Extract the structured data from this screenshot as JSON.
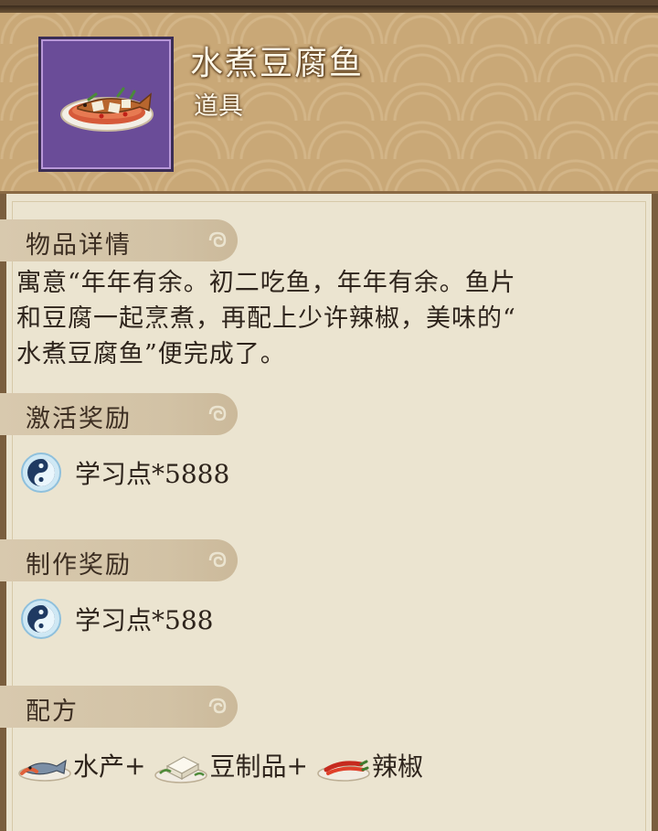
{
  "item": {
    "name": "水煮豆腐鱼",
    "category": "道具",
    "icon": "boiled-tofu-fish-dish-icon",
    "frame_color": "#6a4c98"
  },
  "sections": {
    "details": {
      "title": "物品详情",
      "lines": [
        "寓意“年年有余。初二吃鱼，年年有余。鱼片",
        "和豆腐一起烹煮，再配上少许辣椒，美味的“",
        "水煮豆腐鱼”便完成了。"
      ]
    },
    "activation_reward": {
      "title": "激活奖励",
      "icon": "yin-yang-learning-point-icon",
      "text": "学习点*5888"
    },
    "crafting_reward": {
      "title": "制作奖励",
      "icon": "yin-yang-learning-point-icon",
      "text": "学习点*588"
    },
    "recipe": {
      "title": "配方",
      "ingredients": [
        {
          "icon": "seafood-icon",
          "label": "水产",
          "plus": "+"
        },
        {
          "icon": "tofu-icon",
          "label": "豆制品",
          "plus": "+"
        },
        {
          "icon": "chili-pepper-icon",
          "label": "辣椒",
          "plus": ""
        }
      ]
    }
  },
  "colors": {
    "header_bg": "#c9a877",
    "body_bg": "#ebe4d0",
    "tab_bg": "#d2c2a5",
    "text": "#2e241c"
  }
}
